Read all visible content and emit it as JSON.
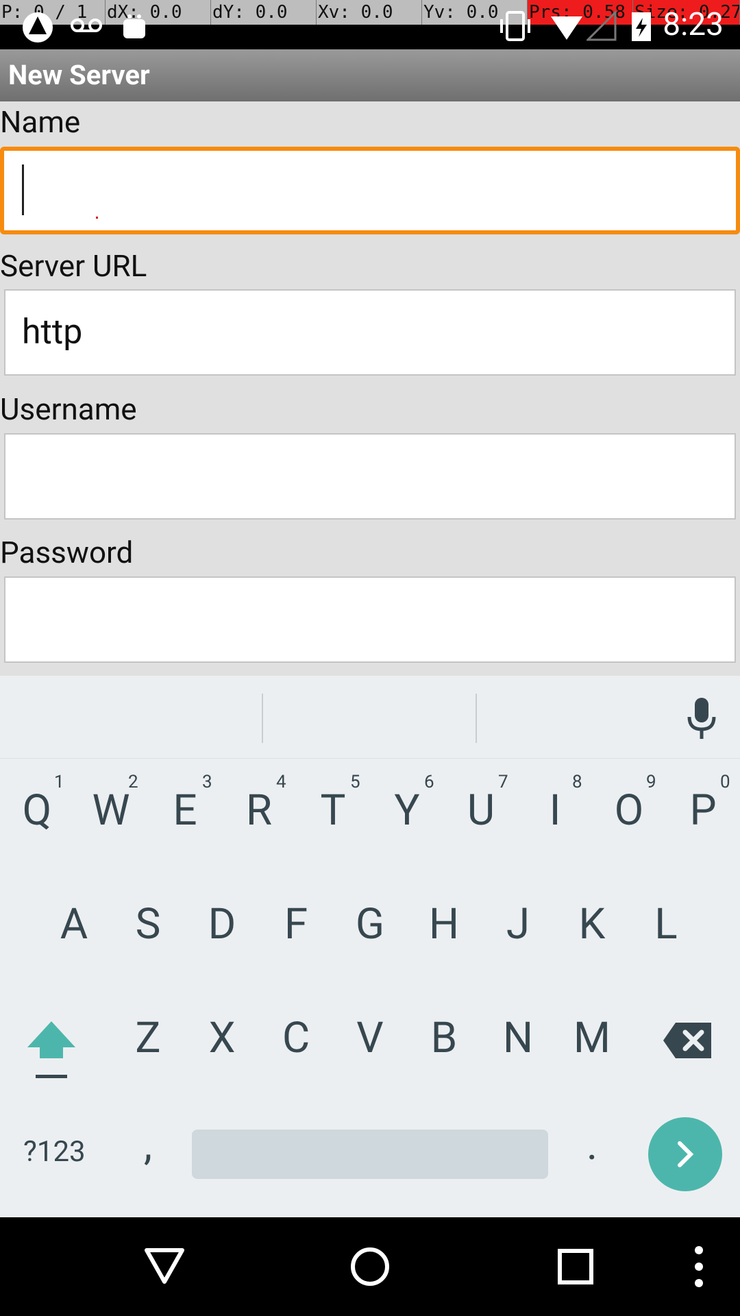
{
  "pointer_location": {
    "p": "P: 0 / 1",
    "dx": "dX: 0.0",
    "dy": "dY: 0.0",
    "xv": "Xv: 0.0",
    "yv": "Yv: 0.0",
    "prs": "Prs: 0.58",
    "size": "Size: 0.27"
  },
  "status_bar": {
    "time": "8:23"
  },
  "title_bar": {
    "title": "New Server"
  },
  "form": {
    "name": {
      "label": "Name",
      "value": ""
    },
    "server_url": {
      "label": "Server URL",
      "value": "http"
    },
    "username": {
      "label": "Username",
      "value": ""
    },
    "password": {
      "label": "Password",
      "value": ""
    }
  },
  "keyboard": {
    "row1": [
      "Q",
      "W",
      "E",
      "R",
      "T",
      "Y",
      "U",
      "I",
      "O",
      "P"
    ],
    "row1_hints": [
      "1",
      "2",
      "3",
      "4",
      "5",
      "6",
      "7",
      "8",
      "9",
      "0"
    ],
    "row2": [
      "A",
      "S",
      "D",
      "F",
      "G",
      "H",
      "J",
      "K",
      "L"
    ],
    "row3": [
      "Z",
      "X",
      "C",
      "V",
      "B",
      "N",
      "M"
    ],
    "symbols_label": "?123",
    "comma": ",",
    "period": "."
  },
  "colors": {
    "focus_border": "#f68b0e",
    "accent": "#4db6ac",
    "key_text": "#37474f",
    "pointer_highlight": "#ee1c1c"
  }
}
